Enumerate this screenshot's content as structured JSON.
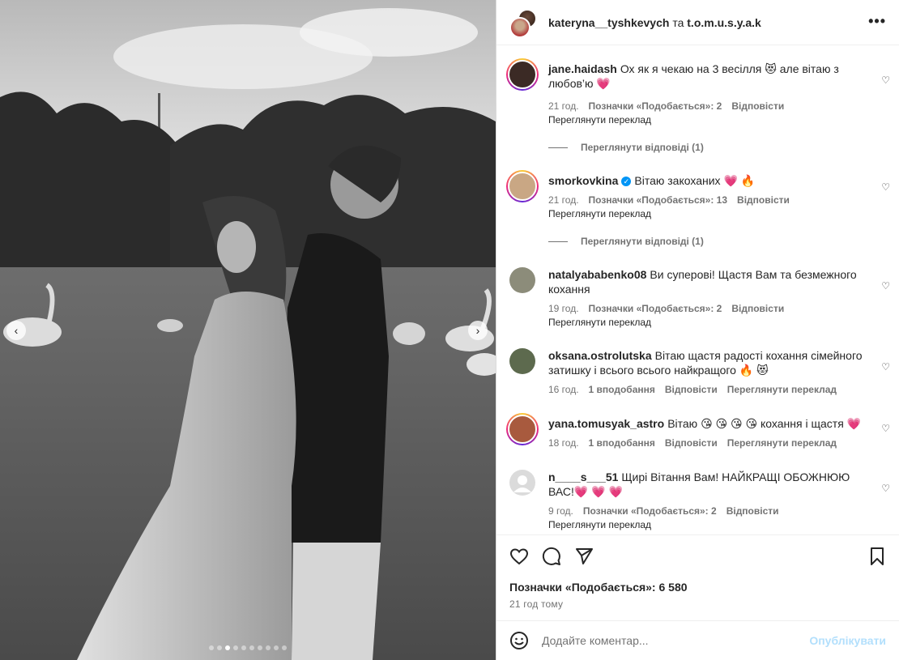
{
  "header": {
    "user1": "kateryna__tyshkevych",
    "conj": "та",
    "user2": "t.o.m.u.s.y.a.k",
    "more_icon": "more-horizontal-icon"
  },
  "media": {
    "prev_glyph": "‹",
    "next_glyph": "›",
    "carousel_count": 10,
    "carousel_active": 2
  },
  "comments": [
    {
      "user": "jane.haidash",
      "text": "Ох як я чекаю на 3 весілля 😻 але вітаю з любов’ю 💗",
      "time": "21 год.",
      "likes": "Позначки «Подобається»: 2",
      "reply": "Відповісти",
      "translate": "Переглянути переклад",
      "view_replies": "Переглянути відповіді (1)"
    },
    {
      "user": "smorkovkina",
      "verified": true,
      "text": "Вітаю закоханих 💗 🔥",
      "time": "21 год.",
      "likes": "Позначки «Подобається»: 13",
      "reply": "Відповісти",
      "translate": "Переглянути переклад",
      "view_replies": "Переглянути відповіді (1)"
    },
    {
      "user": "natalyababenko08",
      "text": "Ви суперові! Щастя Вам та безмежного кохання",
      "time": "19 год.",
      "likes": "Позначки «Подобається»: 2",
      "reply": "Відповісти",
      "translate": "Переглянути переклад"
    },
    {
      "user": "oksana.ostrolutska",
      "text": "Вітаю щастя радості кохання сімейного затишку і всього всього найкращого 🔥 😻",
      "time": "16 год.",
      "likes": "1 вподобання",
      "reply": "Відповісти",
      "translate": "Переглянути переклад"
    },
    {
      "user": "yana.tomusyak_astro",
      "text": "Вітаю 😘 😘 😘 😘 кохання і щастя 💗",
      "time": "18 год.",
      "likes": "1 вподобання",
      "reply": "Відповісти",
      "translate": "Переглянути переклад"
    },
    {
      "user": "n____s___51",
      "text": "Щирі Вітання Вам! НАЙКРАЩІ ОБОЖНЮЮ ВАС!💗 💗 💗",
      "time": "9 год.",
      "likes": "Позначки «Подобається»: 2",
      "reply": "Відповісти",
      "translate": "Переглянути переклад"
    }
  ],
  "footer": {
    "likes_total": "Позначки «Подобається»: 6 580",
    "posted": "21 год тому",
    "comment_placeholder": "Додайте коментар...",
    "publish": "Опублікувати"
  },
  "colors": {
    "link_blue": "#0095f6",
    "publish_disabled": "#b2dffc",
    "muted": "#737373"
  }
}
